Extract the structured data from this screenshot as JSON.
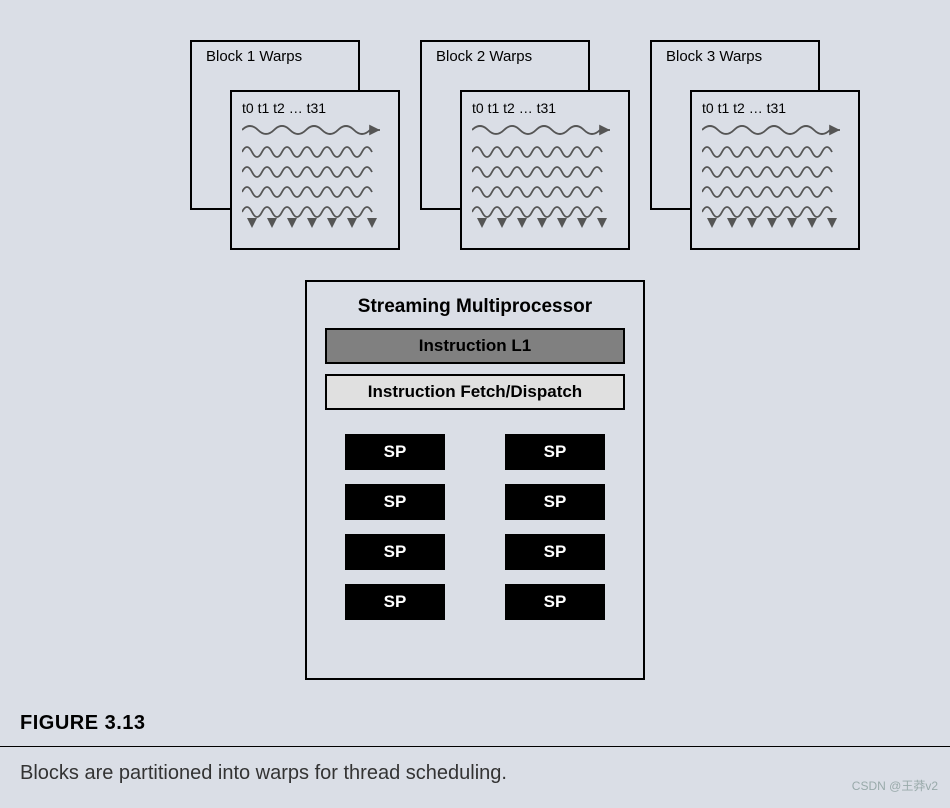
{
  "blocks": [
    {
      "label": "Block 1 Warps",
      "threads": "t0 t1 t2 … t31"
    },
    {
      "label": "Block 2 Warps",
      "threads": "t0 t1 t2 … t31"
    },
    {
      "label": "Block 3 Warps",
      "threads": "t0 t1 t2 … t31"
    }
  ],
  "sm": {
    "title": "Streaming Multiprocessor",
    "l1": "Instruction L1",
    "fetch": "Instruction Fetch/Dispatch",
    "sp_label": "SP",
    "sp_count": 8
  },
  "figure": {
    "number": "FIGURE 3.13",
    "caption": "Blocks are partitioned into warps for thread scheduling."
  },
  "watermark": "CSDN @王莽v2"
}
